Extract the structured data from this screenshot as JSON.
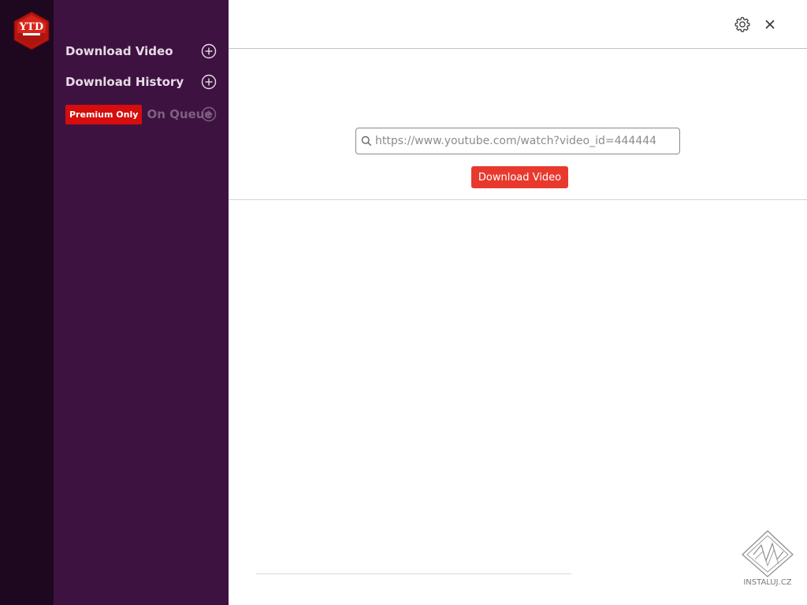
{
  "app": {
    "logo_text": "YTD"
  },
  "sidebar": {
    "items": [
      {
        "label": "Download Video",
        "icon": "plus-circle-icon"
      },
      {
        "label": "Download History",
        "icon": "plus-circle-icon"
      },
      {
        "label": "On Queue",
        "icon": "plus-circle-icon",
        "badge": "Premium Only",
        "disabled": true
      }
    ]
  },
  "header": {
    "settings_icon": "gear-icon",
    "close_icon": "close-icon"
  },
  "main": {
    "url_input": {
      "value": "https://www.youtube.com/watch?video_id=444444",
      "icon": "search-icon"
    },
    "download_button": "Download Video"
  },
  "watermark": {
    "text": "INSTALUJ.CZ"
  },
  "colors": {
    "rail": "#1e0820",
    "sidebar": "#3e1240",
    "accent": "#e8392e",
    "premium_badge": "#d50d0d"
  }
}
